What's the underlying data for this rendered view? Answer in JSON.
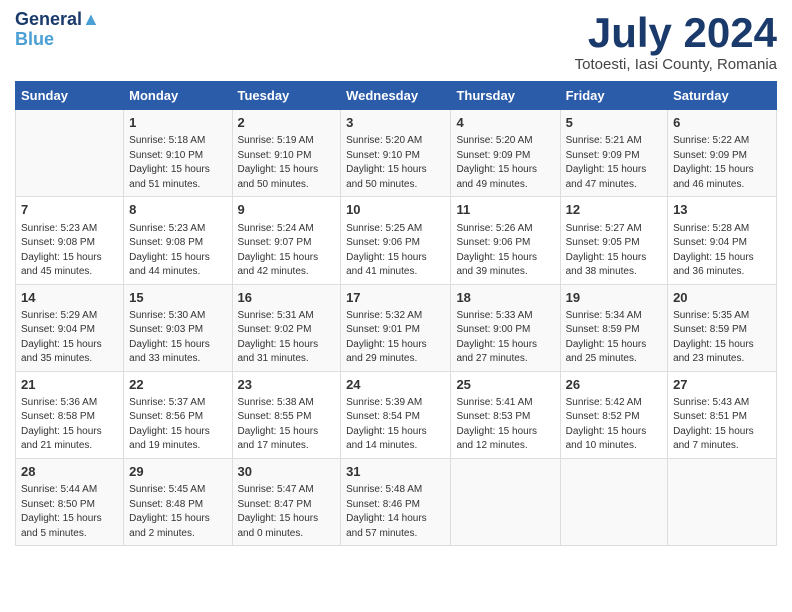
{
  "logo": {
    "line1": "General",
    "line2": "Blue"
  },
  "title": "July 2024",
  "location": "Totoesti, Iasi County, Romania",
  "weekdays": [
    "Sunday",
    "Monday",
    "Tuesday",
    "Wednesday",
    "Thursday",
    "Friday",
    "Saturday"
  ],
  "weeks": [
    [
      {
        "day": "",
        "details": ""
      },
      {
        "day": "1",
        "details": "Sunrise: 5:18 AM\nSunset: 9:10 PM\nDaylight: 15 hours\nand 51 minutes."
      },
      {
        "day": "2",
        "details": "Sunrise: 5:19 AM\nSunset: 9:10 PM\nDaylight: 15 hours\nand 50 minutes."
      },
      {
        "day": "3",
        "details": "Sunrise: 5:20 AM\nSunset: 9:10 PM\nDaylight: 15 hours\nand 50 minutes."
      },
      {
        "day": "4",
        "details": "Sunrise: 5:20 AM\nSunset: 9:09 PM\nDaylight: 15 hours\nand 49 minutes."
      },
      {
        "day": "5",
        "details": "Sunrise: 5:21 AM\nSunset: 9:09 PM\nDaylight: 15 hours\nand 47 minutes."
      },
      {
        "day": "6",
        "details": "Sunrise: 5:22 AM\nSunset: 9:09 PM\nDaylight: 15 hours\nand 46 minutes."
      }
    ],
    [
      {
        "day": "7",
        "details": "Sunrise: 5:23 AM\nSunset: 9:08 PM\nDaylight: 15 hours\nand 45 minutes."
      },
      {
        "day": "8",
        "details": "Sunrise: 5:23 AM\nSunset: 9:08 PM\nDaylight: 15 hours\nand 44 minutes."
      },
      {
        "day": "9",
        "details": "Sunrise: 5:24 AM\nSunset: 9:07 PM\nDaylight: 15 hours\nand 42 minutes."
      },
      {
        "day": "10",
        "details": "Sunrise: 5:25 AM\nSunset: 9:06 PM\nDaylight: 15 hours\nand 41 minutes."
      },
      {
        "day": "11",
        "details": "Sunrise: 5:26 AM\nSunset: 9:06 PM\nDaylight: 15 hours\nand 39 minutes."
      },
      {
        "day": "12",
        "details": "Sunrise: 5:27 AM\nSunset: 9:05 PM\nDaylight: 15 hours\nand 38 minutes."
      },
      {
        "day": "13",
        "details": "Sunrise: 5:28 AM\nSunset: 9:04 PM\nDaylight: 15 hours\nand 36 minutes."
      }
    ],
    [
      {
        "day": "14",
        "details": "Sunrise: 5:29 AM\nSunset: 9:04 PM\nDaylight: 15 hours\nand 35 minutes."
      },
      {
        "day": "15",
        "details": "Sunrise: 5:30 AM\nSunset: 9:03 PM\nDaylight: 15 hours\nand 33 minutes."
      },
      {
        "day": "16",
        "details": "Sunrise: 5:31 AM\nSunset: 9:02 PM\nDaylight: 15 hours\nand 31 minutes."
      },
      {
        "day": "17",
        "details": "Sunrise: 5:32 AM\nSunset: 9:01 PM\nDaylight: 15 hours\nand 29 minutes."
      },
      {
        "day": "18",
        "details": "Sunrise: 5:33 AM\nSunset: 9:00 PM\nDaylight: 15 hours\nand 27 minutes."
      },
      {
        "day": "19",
        "details": "Sunrise: 5:34 AM\nSunset: 8:59 PM\nDaylight: 15 hours\nand 25 minutes."
      },
      {
        "day": "20",
        "details": "Sunrise: 5:35 AM\nSunset: 8:59 PM\nDaylight: 15 hours\nand 23 minutes."
      }
    ],
    [
      {
        "day": "21",
        "details": "Sunrise: 5:36 AM\nSunset: 8:58 PM\nDaylight: 15 hours\nand 21 minutes."
      },
      {
        "day": "22",
        "details": "Sunrise: 5:37 AM\nSunset: 8:56 PM\nDaylight: 15 hours\nand 19 minutes."
      },
      {
        "day": "23",
        "details": "Sunrise: 5:38 AM\nSunset: 8:55 PM\nDaylight: 15 hours\nand 17 minutes."
      },
      {
        "day": "24",
        "details": "Sunrise: 5:39 AM\nSunset: 8:54 PM\nDaylight: 15 hours\nand 14 minutes."
      },
      {
        "day": "25",
        "details": "Sunrise: 5:41 AM\nSunset: 8:53 PM\nDaylight: 15 hours\nand 12 minutes."
      },
      {
        "day": "26",
        "details": "Sunrise: 5:42 AM\nSunset: 8:52 PM\nDaylight: 15 hours\nand 10 minutes."
      },
      {
        "day": "27",
        "details": "Sunrise: 5:43 AM\nSunset: 8:51 PM\nDaylight: 15 hours\nand 7 minutes."
      }
    ],
    [
      {
        "day": "28",
        "details": "Sunrise: 5:44 AM\nSunset: 8:50 PM\nDaylight: 15 hours\nand 5 minutes."
      },
      {
        "day": "29",
        "details": "Sunrise: 5:45 AM\nSunset: 8:48 PM\nDaylight: 15 hours\nand 2 minutes."
      },
      {
        "day": "30",
        "details": "Sunrise: 5:47 AM\nSunset: 8:47 PM\nDaylight: 15 hours\nand 0 minutes."
      },
      {
        "day": "31",
        "details": "Sunrise: 5:48 AM\nSunset: 8:46 PM\nDaylight: 14 hours\nand 57 minutes."
      },
      {
        "day": "",
        "details": ""
      },
      {
        "day": "",
        "details": ""
      },
      {
        "day": "",
        "details": ""
      }
    ]
  ]
}
